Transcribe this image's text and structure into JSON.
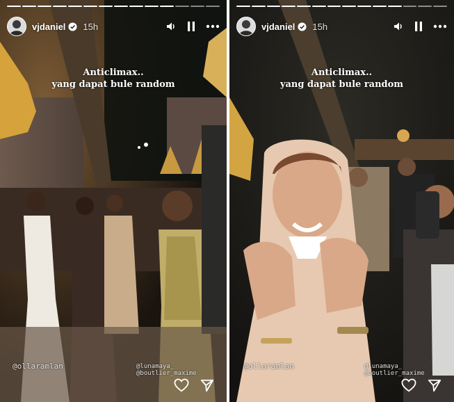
{
  "stories": [
    {
      "username": "vjdaniel",
      "time": "15h",
      "caption_line1": "Anticlimax..",
      "caption_line2": "yang dapat bule random",
      "mention_left": "@ollaramlan",
      "mention_right": "@lunamaya_ @boutlier_maxime"
    },
    {
      "username": "vjdaniel",
      "time": "15h",
      "caption_line1": "Anticlimax..",
      "caption_line2": "yang dapat bule random",
      "mention_left": "@ollaramlan",
      "mention_right": "@lunamaya_ @boutlier_maxime"
    }
  ],
  "icons": [
    "avatar",
    "verified-badge-icon",
    "volume-icon",
    "pause-icon",
    "more-icon",
    "heart-icon",
    "send-icon"
  ],
  "colors": {
    "text": "#ffffff",
    "verified": "#ffffff"
  }
}
